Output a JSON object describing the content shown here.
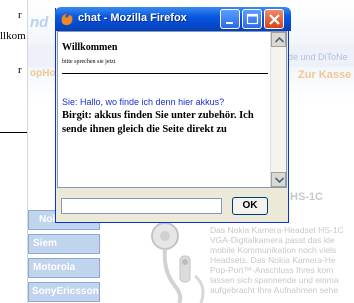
{
  "background": {
    "left_column": {
      "text_1": "r",
      "text_2": "llkom",
      "text_3": "r"
    },
    "logo_text": "nd",
    "header_link_left": "opHo",
    "header_link_right": "de und DiToNe",
    "cart_label": "Zur Kasse",
    "sidebar_items": [
      "Nok",
      "Siem",
      "Motorola",
      "SonyEricsson"
    ],
    "product_title": "HS-1C",
    "product_description": "Das Nokia Kamera-Headset HS-1C VGA-Digitalkamera passt das kle mobile Kommunikation noch viels Headsets. Das Nokia Kamera-He Pop-Port™-Anschluss Ihres kom lassen sich spannende und einma aufgebracht Ihre Aufnahmen sehe"
  },
  "popup": {
    "title": "chat - Mozilla Firefox",
    "welcome_title": "Willkommen",
    "welcome_subtitle": "bitte sprechen sie jetzt",
    "messages": [
      {
        "speaker": "Sie",
        "text": "Sie: Hallo, wo finde ich denn hier akkus?"
      },
      {
        "speaker": "Birgit",
        "text": "Birgit: akkus finden Sie unter zubehör. Ich sende ihnen gleich die Seite direkt zu"
      }
    ],
    "input_value": "",
    "ok_label": "OK",
    "colors": {
      "titlebar": "#0a58e0",
      "user_message": "#1a30d0",
      "agent_message": "#000000"
    }
  }
}
